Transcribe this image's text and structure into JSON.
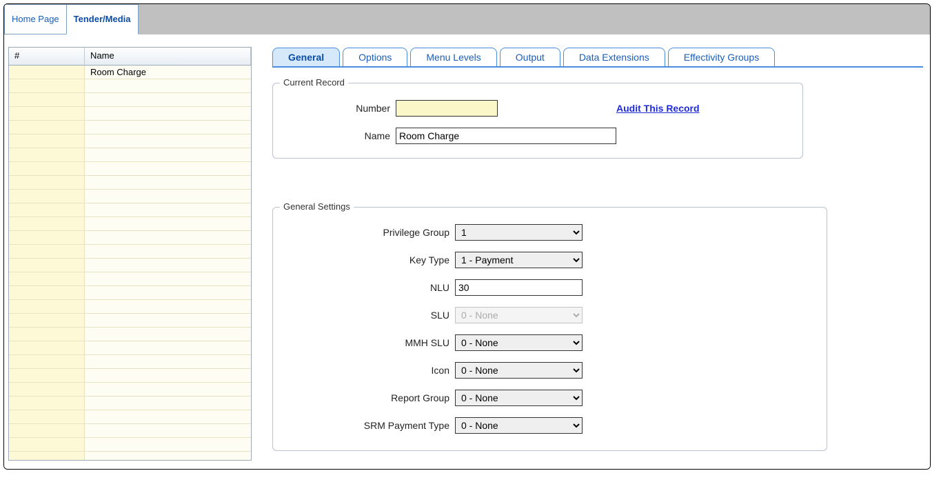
{
  "topTabs": {
    "home": "Home Page",
    "tender": "Tender/Media"
  },
  "grid": {
    "colNum": "#",
    "colName": "Name",
    "rows": [
      {
        "num": "",
        "name": "Room Charge"
      }
    ]
  },
  "contentTabs": {
    "general": "General",
    "options": "Options",
    "menuLevels": "Menu Levels",
    "output": "Output",
    "dataExtensions": "Data Extensions",
    "effectivityGroups": "Effectivity Groups"
  },
  "currentRecord": {
    "legend": "Current Record",
    "numberLabel": "Number",
    "numberValue": "",
    "nameLabel": "Name",
    "nameValue": "Room Charge",
    "auditLink": "Audit This Record"
  },
  "generalSettings": {
    "legend": "General Settings",
    "privilegeGroupLabel": "Privilege Group",
    "privilegeGroupValue": "1",
    "keyTypeLabel": "Key Type",
    "keyTypeValue": "1 - Payment",
    "nluLabel": "NLU",
    "nluValue": "30",
    "sluLabel": "SLU",
    "sluValue": "0 - None",
    "mmhSluLabel": "MMH SLU",
    "mmhSluValue": "0 - None",
    "iconLabel": "Icon",
    "iconValue": "0 - None",
    "reportGroupLabel": "Report Group",
    "reportGroupValue": "0 - None",
    "srmPaymentTypeLabel": "SRM Payment Type",
    "srmPaymentTypeValue": "0 - None"
  }
}
